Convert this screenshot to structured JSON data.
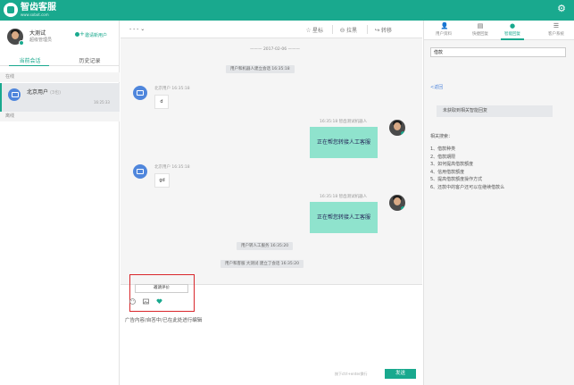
{
  "app": {
    "title": "智齿客服",
    "subtitle": "www.sobot.com"
  },
  "agent": {
    "name": "大测试",
    "role": "超级管理员",
    "invite_label": "邀请新用户"
  },
  "left_tabs": {
    "current": "当前会话",
    "history": "历史记录"
  },
  "sections": {
    "online": "在线",
    "offline": "离线"
  },
  "session": {
    "name": "北京用户",
    "tag": "(3也)",
    "time": "16:25:33"
  },
  "chat_header": {
    "selector": "- - -",
    "star_label": "星标",
    "block_label": "拉黑",
    "transfer_label": "转移"
  },
  "messages": {
    "date": "2017-02-06",
    "sys1": "用户和机器人建立会话 16:35:18",
    "user1_meta": "北京用户  16:35:18",
    "user1_text": "d",
    "agent1_meta": "16:35:18  智齿测试机器人",
    "agent1_text": "正在帮您转接人工客服",
    "user2_meta": "北京用户  16:35:18",
    "user2_text": "gd",
    "agent2_meta": "16:35:18  智齿测试机器人",
    "agent2_text": "正在帮您转接人工客服",
    "sys2": "用户转人工服务 16:35:20",
    "sys3": "用户和客服 大测试 建立了会话 16:35:20"
  },
  "compose": {
    "eval_button": "邀请评价",
    "placeholder": "广告内容/自答中/已在此处进行编辑",
    "hint": "按下ctrl+enter换行",
    "send_label": "发送"
  },
  "right_tabs": [
    {
      "icon": "user-icon",
      "label": "用户资料"
    },
    {
      "icon": "tag-icon",
      "label": "快捷回复"
    },
    {
      "icon": "robot-icon",
      "label": "智能回复"
    },
    {
      "icon": "menu-icon",
      "label": "客户系统"
    }
  ],
  "right_panel": {
    "search_value": "借款",
    "back_label": "<返回",
    "no_answer": "未获取到相关智能回复",
    "related_heading": "相关搜索：",
    "questions": [
      "1、借款种类",
      "2、借款期限",
      "3、如何提高借款额度",
      "4、信用借款额度",
      "5、提高借款额度操作方式",
      "6、还款中的客户还可以在继续借款么"
    ]
  },
  "colors": {
    "brand": "#19a98e",
    "agent_bubble": "#8fe3cd",
    "bot_avatar": "#4f86dc",
    "highlight_box": "#d9262b"
  }
}
